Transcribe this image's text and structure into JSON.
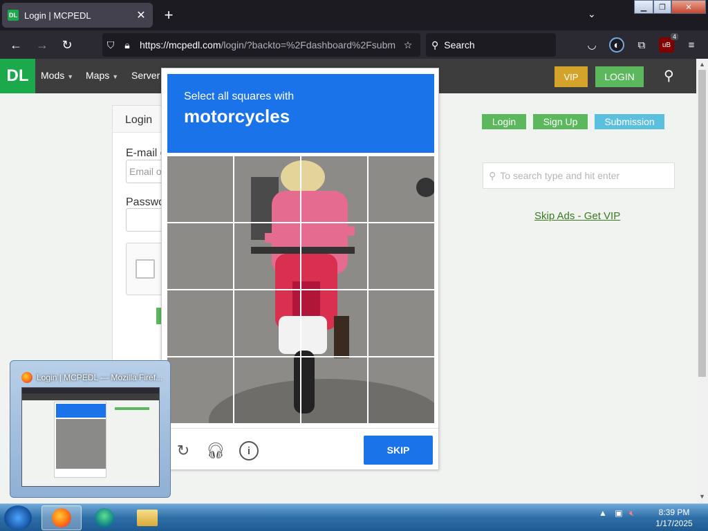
{
  "browser": {
    "tab_title": "Login | MCPEDL",
    "favicon_text": "DL",
    "tab_close": "✕",
    "new_tab": "+",
    "url_host": "https://mcpedl.com",
    "url_path": "/login/?backto=%2Fdashboard%2Fsubm",
    "search_placeholder": "Search",
    "ublock_badge": "4"
  },
  "site": {
    "logo": "DL",
    "menu": [
      "Mods",
      "Maps",
      "Server"
    ],
    "vip_label": "VIP",
    "login_label": "LOGIN",
    "login_panel_title": "Login",
    "email_label": "E-mail o",
    "email_placeholder": "Email o",
    "password_label": "Passwo",
    "side_login": "Login",
    "side_signup": "Sign Up",
    "side_submission": "Submission",
    "side_search_placeholder": "To search type and hit enter",
    "skip_ads": "Skip Ads - Get VIP",
    "colors": {
      "green": "#1ba94c",
      "vip": "#d4a32a",
      "blue": "#5bc0de",
      "header": "#3d3d3d"
    }
  },
  "captcha": {
    "instruction": "Select all squares with",
    "target": "motorcycles",
    "skip_label": "SKIP",
    "grid_rows": 4,
    "grid_cols": 4,
    "accent": "#1a73e8"
  },
  "preview": {
    "title": "Login | MCPEDL — Mozilla Firef..."
  },
  "taskbar": {
    "time": "8:39 PM",
    "date": "1/17/2025"
  }
}
